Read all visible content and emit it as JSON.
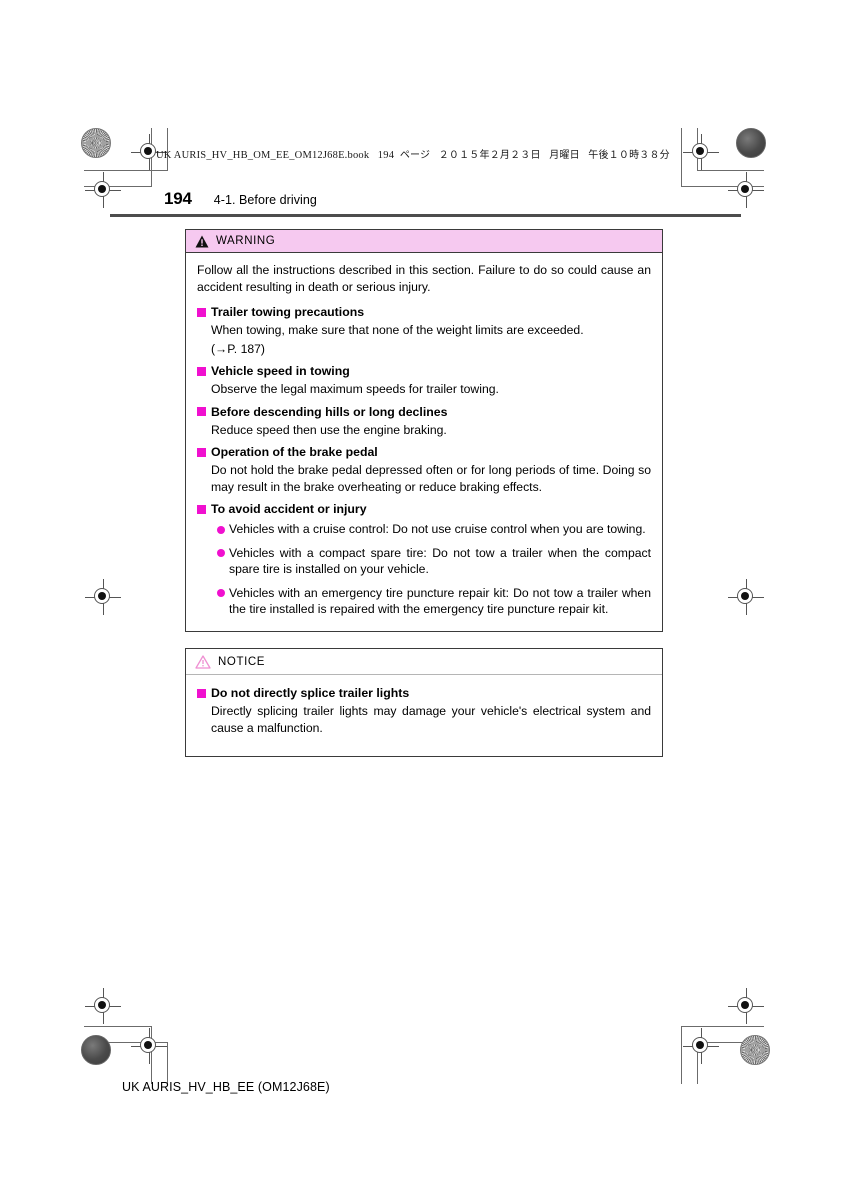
{
  "header": {
    "print_info": "UK AURIS_HV_HB_OM_EE_OM12J68E.book",
    "print_page": "194",
    "print_page_unit": "ページ",
    "print_date": "２０１５年２月２３日",
    "print_weekday": "月曜日",
    "print_time": "午後１０時３８分"
  },
  "page": {
    "number": "194",
    "section": "4-1. Before driving",
    "footer_code": "UK AURIS_HV_HB_EE (OM12J68E)"
  },
  "colors": {
    "warning_header_bg": "#f6c9f0",
    "bullet_magenta": "#f010cf",
    "notice_triangle": "#ef8fd2",
    "rule": "#4d4d4d"
  },
  "warning": {
    "icon": "warning-triangle-icon",
    "label": "WARNING",
    "intro": "Follow all the instructions described in this section. Failure to do so could cause an accident resulting in death or serious injury.",
    "sections": [
      {
        "heading": "Trailer towing precautions",
        "paragraphs": [
          "When towing, make sure that none of the weight limits are exceeded.",
          "(→P. 187)"
        ]
      },
      {
        "heading": "Vehicle speed in towing",
        "paragraphs": [
          "Observe the legal maximum speeds for trailer towing."
        ]
      },
      {
        "heading": "Before descending hills or long declines",
        "paragraphs": [
          "Reduce speed then use the engine braking."
        ]
      },
      {
        "heading": "Operation of the brake pedal",
        "paragraphs": [
          "Do not hold the brake pedal depressed often or for long periods of time. Doing so may result in the brake overheating or reduce braking effects."
        ]
      },
      {
        "heading": "To avoid accident or injury",
        "bullets": [
          "Vehicles with a cruise control: Do not use cruise control when you are towing.",
          "Vehicles with a compact spare tire: Do not tow a trailer when the compact spare tire is installed on your vehicle.",
          "Vehicles with an emergency tire puncture repair kit: Do not tow a trailer when the tire installed is repaired with the emergency tire puncture repair kit."
        ]
      }
    ]
  },
  "notice": {
    "icon": "notice-triangle-icon",
    "label": "NOTICE",
    "sections": [
      {
        "heading": "Do not directly splice trailer lights",
        "paragraphs": [
          "Directly splicing trailer lights may damage your vehicle's electrical system and cause a malfunction."
        ]
      }
    ]
  }
}
